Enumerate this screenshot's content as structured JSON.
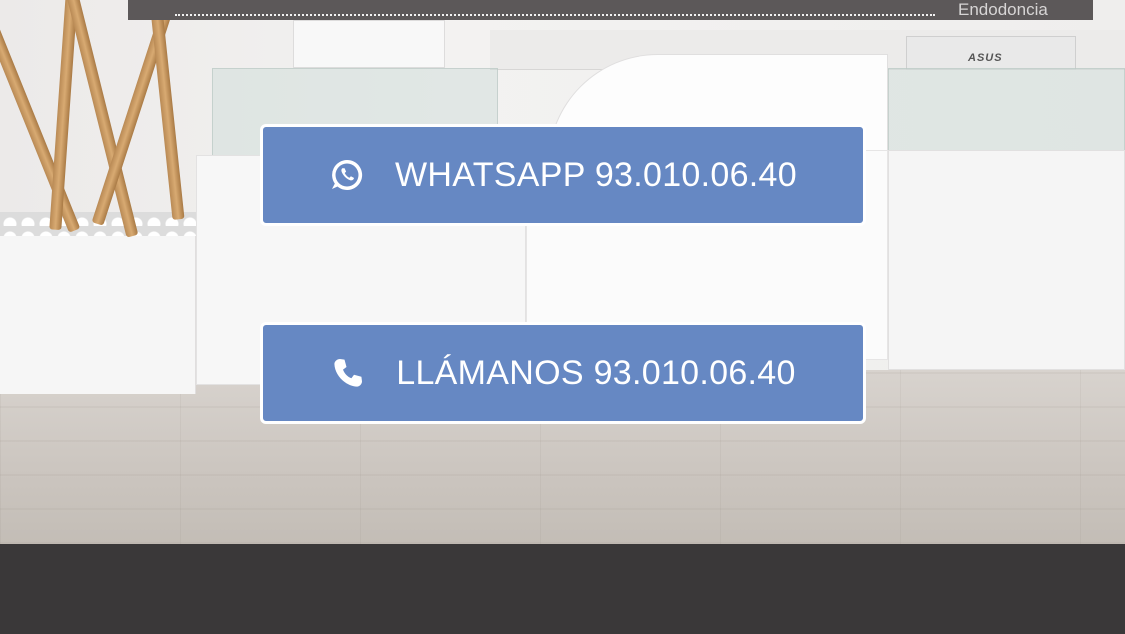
{
  "header_strip": {
    "visible_text": "Endodoncia"
  },
  "monitor": {
    "brand": "ASUS"
  },
  "buttons": {
    "whatsapp": {
      "label": "WHATSAPP 93.010.06.40",
      "icon": "whatsapp-icon"
    },
    "call": {
      "label": "LLÁMANOS 93.010.06.40",
      "icon": "phone-icon"
    }
  },
  "colors": {
    "button_bg": "#6688c3",
    "button_border": "#ffffff",
    "footer": "#3a3839"
  }
}
